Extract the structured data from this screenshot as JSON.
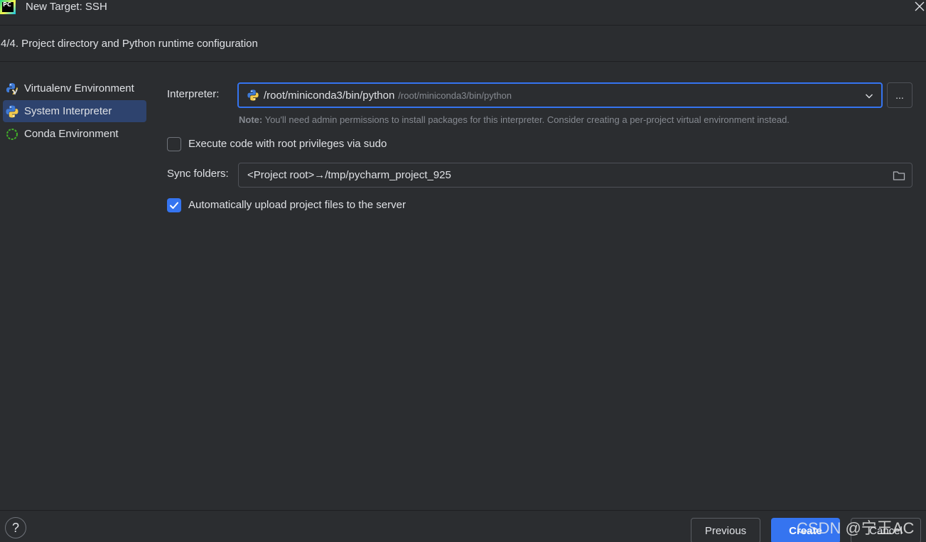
{
  "window": {
    "title": "New Target: SSH",
    "logo_text": "PC"
  },
  "step": {
    "header": "4/4. Project directory and Python runtime configuration"
  },
  "nav": {
    "items": [
      {
        "label": "Virtualenv Environment",
        "icon": "virtualenv-icon"
      },
      {
        "label": "System Interpreter",
        "icon": "python-icon",
        "selected": true
      },
      {
        "label": "Conda Environment",
        "icon": "conda-icon"
      }
    ]
  },
  "form": {
    "interpreter_label": "Interpreter:",
    "interpreter_value": "/root/miniconda3/bin/python",
    "interpreter_path_hint": "/root/miniconda3/bin/python",
    "browse_label": "...",
    "note_prefix": "Note:",
    "note_text": " You'll need admin permissions to install packages for this interpreter. Consider creating a per-project virtual environment instead.",
    "sudo_label": "Execute code with root privileges via sudo",
    "sudo_checked": false,
    "sync_label": "Sync folders:",
    "sync_value": "<Project root>→/tmp/pycharm_project_925",
    "upload_label": "Automatically upload project files to the server",
    "upload_checked": true
  },
  "footer": {
    "help_label": "?",
    "previous_label": "Previous",
    "create_label": "Create",
    "cancel_label": "Cancel"
  },
  "watermark": "CSDN @宁王AC",
  "colors": {
    "background": "#2b2d30",
    "accent": "#3574f0",
    "selection": "#2e436e",
    "muted_text": "#868a91"
  }
}
